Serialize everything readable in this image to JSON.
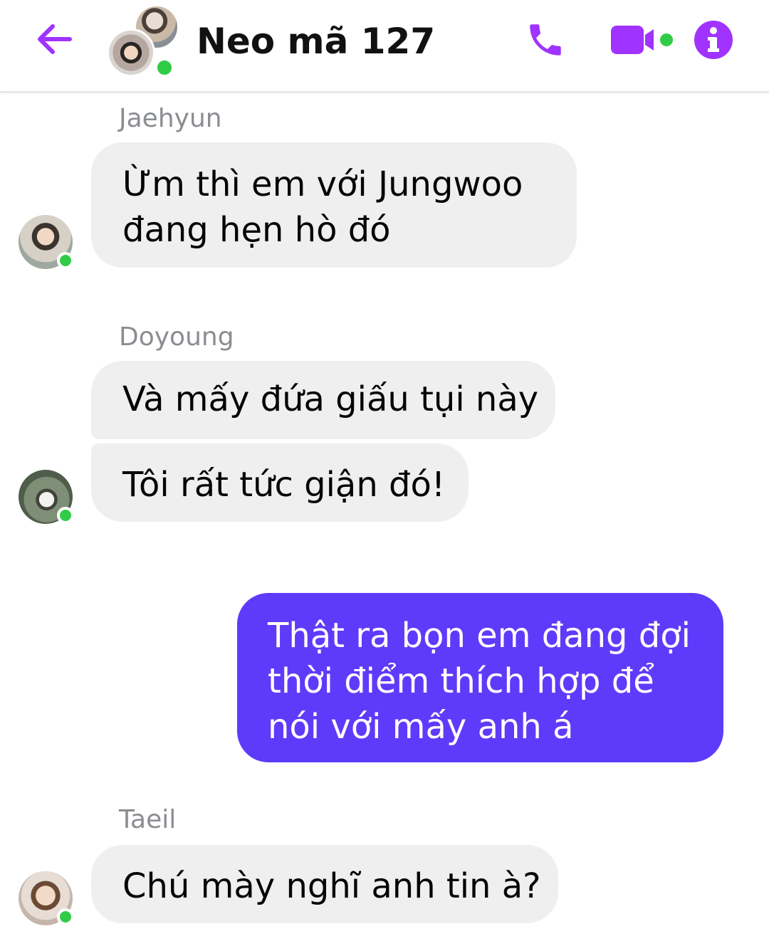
{
  "header": {
    "title": "Neo mã 127",
    "back_icon": "arrow-left-icon",
    "call_icon": "phone-icon",
    "video_icon": "video-camera-icon",
    "info_icon": "info-icon",
    "accent_color": "#a033ff",
    "online_color": "#31cc46"
  },
  "messages": [
    {
      "sender": "Jaehyun",
      "lines": [
        "Ừm thì em với Jungwoo",
        "đang hẹn hò đó"
      ]
    },
    {
      "sender": "Doyoung",
      "lines": [
        "Và mấy đứa giấu tụi này"
      ]
    },
    {
      "sender": "",
      "lines": [
        "Tôi rất tức giận đó!"
      ]
    },
    {
      "sender": "me",
      "lines": [
        "Thật ra bọn em đang đợi",
        "thời điểm thích hợp để",
        "nói với mấy anh á"
      ]
    },
    {
      "sender": "Taeil",
      "lines": [
        "Chú mày nghĩ anh tin à?"
      ]
    }
  ],
  "colors": {
    "incoming_bubble": "#efefef",
    "outgoing_bubble": "#5e3bfa",
    "sender_name": "#8a8d91"
  }
}
